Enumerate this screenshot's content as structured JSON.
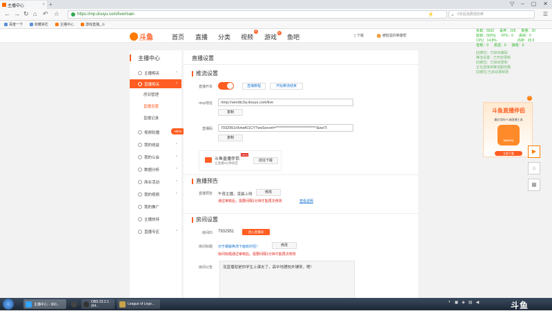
{
  "browser": {
    "tab_title": "主播中心",
    "tab_close": "×",
    "new_tab": "+",
    "url": "https://mp.douyu.com/live/main",
    "search_placeholder": "5天后消费抵扣券",
    "bookmarks": [
      "百度一下",
      "收藏夹栏",
      "主播中心",
      "游戏直播_斗"
    ]
  },
  "header": {
    "logo_text": "斗鱼",
    "logo_sub": "DOUYU.COM",
    "nav": [
      "首页",
      "直播",
      "分类",
      "视频",
      "游戏",
      "鱼吧"
    ],
    "video_badge": "N",
    "game_badge": "N",
    "download": "下载",
    "user": "被脸蛋的英雄帮"
  },
  "stats": {
    "row1": [
      "负载：5502",
      "丢弃：226",
      "数量：20"
    ],
    "row2": [
      "延帧：0(0%)",
      "FPS：0",
      "丢帧：0"
    ],
    "row3": [
      "CPU：14.8%",
      "",
      "内存：25.5"
    ],
    "row4": [
      "音频：0",
      "发送：0",
      "接收：0"
    ],
    "green1": "[0]被拉：已启动编码",
    "green2": "推流设置：已开启录制",
    "green3": "[0]被拉：已启动录制",
    "green4": "正在连接到推流服务器",
    "green5": "[0]被拉:已启动录制场"
  },
  "sidebar": {
    "title": "主播中心",
    "items": [
      {
        "label": "主播相关",
        "arrow": "^"
      },
      {
        "label": "直播相关",
        "arrow": "^"
      },
      {
        "label": "房间管理"
      },
      {
        "label": "直播设置"
      },
      {
        "label": "直播记录"
      },
      {
        "label": "视频轮播",
        "arrow": "^"
      },
      {
        "label": "我的收益",
        "arrow": "^"
      },
      {
        "label": "我的公会",
        "arrow": "^"
      },
      {
        "label": "数据分析",
        "arrow": "^"
      },
      {
        "label": "商业活动",
        "arrow": "^"
      },
      {
        "label": "我的视频",
        "arrow": "^"
      },
      {
        "label": "我的推广"
      },
      {
        "label": "主播扶持"
      },
      {
        "label": "直播专区",
        "arrow": "^"
      }
    ],
    "new_tag": "NEW"
  },
  "main": {
    "title": "直播设置",
    "sec_push": "推流设置",
    "push_switch_label": "直播开关",
    "btn_tutorial": "直播教程",
    "btn_record": "开始推流结束",
    "rtmp_label": "rtmp地址",
    "rtmp_value": "rtmp://sendtc3a.douyu.com/live",
    "copy1": "复制",
    "code_label": "直播码",
    "code_value": "7932951r9vtwKl1CY?wsSecret=****************************&wsTi",
    "copy2": "复制",
    "promo_title": "斗鱼直播伴侣",
    "promo_sub": "让直播5分钟搞定",
    "promo_new": "NEW",
    "promo_btn": "前往下载",
    "sec_preview": "直播预告",
    "preview_label": "直播预告",
    "preview_text": "午夜主播，凌晨上线",
    "preview_edit": "修改",
    "preview_warn": "通过审核后，需要间隔1分钟才能再次修改",
    "preview_help": "查看说明",
    "sec_room": "房间设置",
    "roomid_label": "房间ID",
    "roomid_value": "7932951",
    "roomid_btn": "进入直播间",
    "roomtitle_label": "房间标题",
    "roomtitle_value": "对于缓解焦虑下面有妙招！",
    "roomtitle_edit": "修改",
    "roomtitle_warn": "房间标题通过审核后，需要间隔1分钟才能再次修改",
    "notice_label": "房间公告",
    "notice_value": "没直播就是你学生上课去了，高中地理校外辅导，嗯！"
  },
  "ad": {
    "close": "×",
    "title": "斗鱼直播伴侣",
    "sub": "最好用的PC端直播工具",
    "brand": "DOUYU",
    "btn": "立即下载"
  },
  "taskbar": {
    "tasks": [
      "主播中心 - 360...",
      "",
      "OBS 23.2.1 (64...",
      "League of Lege..."
    ],
    "clock": "斗鱼"
  }
}
